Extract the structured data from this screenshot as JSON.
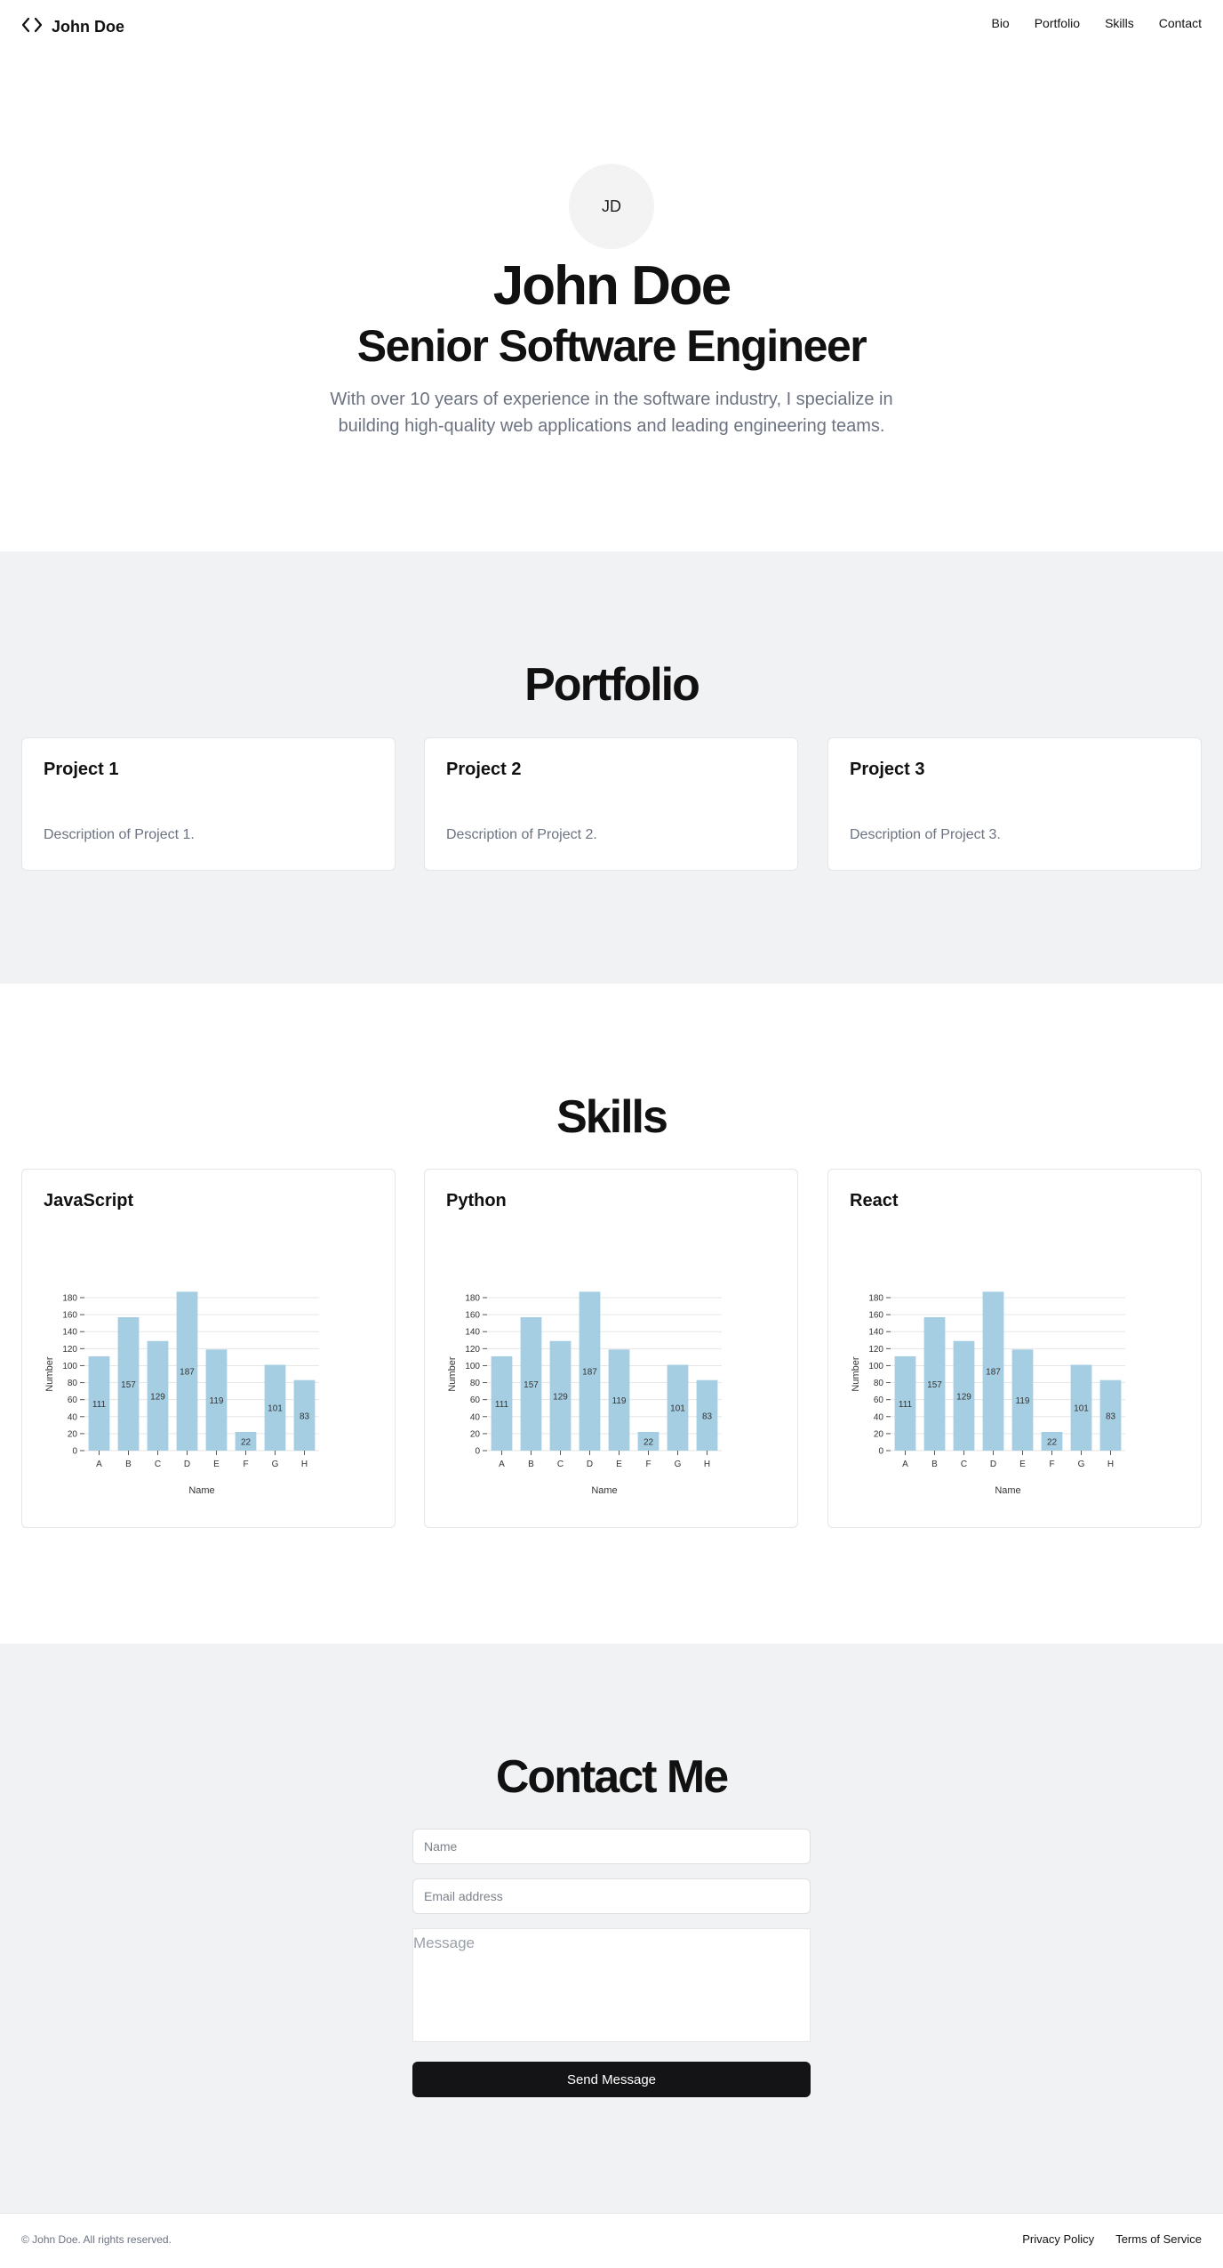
{
  "header": {
    "brand_name": "John Doe",
    "brand_icon": "code-icon",
    "nav": [
      {
        "label": "Bio"
      },
      {
        "label": "Portfolio"
      },
      {
        "label": "Skills"
      },
      {
        "label": "Contact"
      }
    ]
  },
  "hero": {
    "avatar_initials": "JD",
    "name": "John Doe",
    "title": "Senior Software Engineer",
    "description": "With over 10 years of experience in the software industry, I specialize in building high-quality web applications and leading engineering teams."
  },
  "portfolio": {
    "title": "Portfolio",
    "projects": [
      {
        "title": "Project 1",
        "description": "Description of Project 1."
      },
      {
        "title": "Project 2",
        "description": "Description of Project 2."
      },
      {
        "title": "Project 3",
        "description": "Description of Project 3."
      }
    ]
  },
  "skills": {
    "title": "Skills",
    "items": [
      {
        "title": "JavaScript"
      },
      {
        "title": "Python"
      },
      {
        "title": "React"
      }
    ]
  },
  "chart_data": [
    {
      "type": "bar",
      "categories": [
        "A",
        "B",
        "C",
        "D",
        "E",
        "F",
        "G",
        "H"
      ],
      "values": [
        111,
        157,
        129,
        187,
        119,
        22,
        101,
        83
      ],
      "xlabel": "Name",
      "ylabel": "Number",
      "ylim": [
        0,
        180
      ],
      "yticks": [
        0,
        20,
        40,
        60,
        80,
        100,
        120,
        140,
        160,
        180
      ],
      "grid": true,
      "bar_color": "#a6cee3"
    },
    {
      "type": "bar",
      "categories": [
        "A",
        "B",
        "C",
        "D",
        "E",
        "F",
        "G",
        "H"
      ],
      "values": [
        111,
        157,
        129,
        187,
        119,
        22,
        101,
        83
      ],
      "xlabel": "Name",
      "ylabel": "Number",
      "ylim": [
        0,
        180
      ],
      "yticks": [
        0,
        20,
        40,
        60,
        80,
        100,
        120,
        140,
        160,
        180
      ],
      "grid": true,
      "bar_color": "#a6cee3"
    },
    {
      "type": "bar",
      "categories": [
        "A",
        "B",
        "C",
        "D",
        "E",
        "F",
        "G",
        "H"
      ],
      "values": [
        111,
        157,
        129,
        187,
        119,
        22,
        101,
        83
      ],
      "xlabel": "Name",
      "ylabel": "Number",
      "ylim": [
        0,
        180
      ],
      "yticks": [
        0,
        20,
        40,
        60,
        80,
        100,
        120,
        140,
        160,
        180
      ],
      "grid": true,
      "bar_color": "#a6cee3"
    }
  ],
  "contact": {
    "title": "Contact Me",
    "name_placeholder": "Name",
    "email_placeholder": "Email address",
    "message_placeholder": "Message",
    "send_label": "Send Message"
  },
  "footer": {
    "copyright": "© John Doe. All rights reserved.",
    "links": [
      {
        "label": "Privacy Policy"
      },
      {
        "label": "Terms of Service"
      }
    ]
  }
}
